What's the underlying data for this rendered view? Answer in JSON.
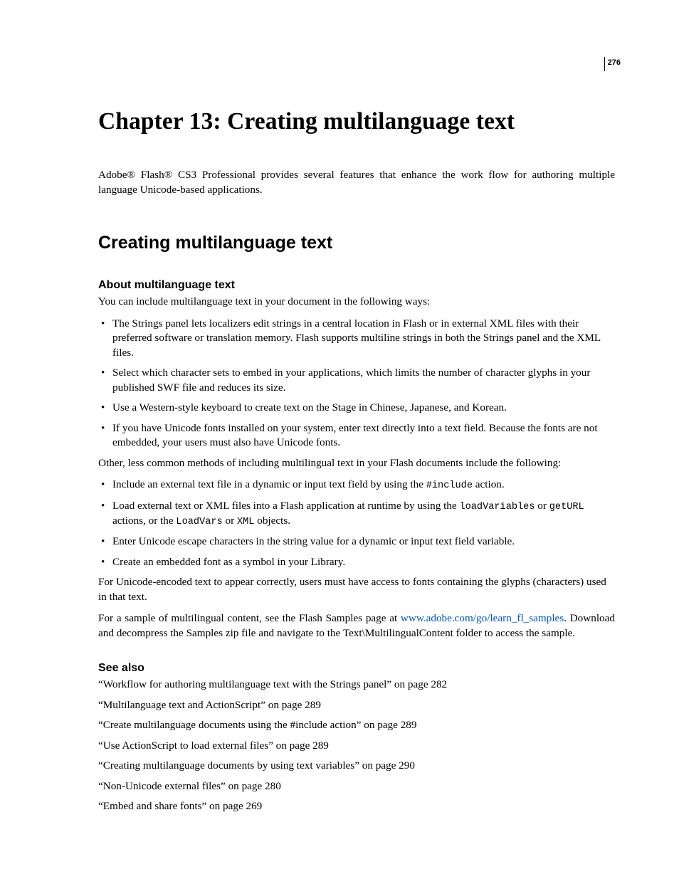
{
  "page_number": "276",
  "chapter_title": "Chapter 13: Creating multilanguage text",
  "intro": "Adobe® Flash® CS3 Professional provides several features that enhance the work flow for authoring multiple language Unicode-based applications.",
  "section_heading": "Creating multilanguage text",
  "subsection_heading": "About multilanguage text",
  "lead_in": "You can include multilanguage text in your document in the following ways:",
  "bullets_primary": [
    "The Strings panel lets localizers edit strings in a central location in Flash or in external XML files with their preferred software or translation memory. Flash supports multiline strings in both the Strings panel and the XML files.",
    "Select which character sets to embed in your applications, which limits the number of character glyphs in your published SWF file and reduces its size.",
    "Use a Western-style keyboard to create text on the Stage in Chinese, Japanese, and Korean.",
    "If you have Unicode fonts installed on your system, enter text directly into a text field. Because the fonts are not embedded, your users must also have Unicode fonts."
  ],
  "mid_para": "Other, less common methods of including multilingual text in your Flash documents include the following:",
  "bullet_include_pre": "Include an external text file in a dynamic or input text field by using the ",
  "bullet_include_code": "#include",
  "bullet_include_post": " action.",
  "bullet_load_pre": "Load external text or XML files into a Flash application at runtime by using the ",
  "bullet_load_code1": "loadVariables",
  "bullet_load_or1": " or ",
  "bullet_load_code2": "getURL",
  "bullet_load_mid": " actions, or the ",
  "bullet_load_code3": "LoadVars",
  "bullet_load_or2": " or ",
  "bullet_load_code4": "XML",
  "bullet_load_post": " objects.",
  "bullets_secondary_tail": [
    "Enter Unicode escape characters in the string value for a dynamic or input text field variable.",
    "Create an embedded font as a symbol in your Library."
  ],
  "unicode_para": "For Unicode-encoded text to appear correctly, users must have access to fonts containing the glyphs (characters) used in that text.",
  "sample_pre": "For a sample of multilingual content, see the Flash Samples page at ",
  "sample_link": "www.adobe.com/go/learn_fl_samples",
  "sample_post": ". Download and decompress the Samples zip file and navigate to the Text\\MultilingualContent folder to access the sample.",
  "see_also_heading": "See also",
  "see_also": [
    "“Workflow for authoring multilanguage text with the Strings panel” on page 282",
    "“Multilanguage text and ActionScript” on page 289",
    "“Create multilanguage documents using the #include action” on page 289",
    "“Use ActionScript to load external files” on page 289",
    "“Creating multilanguage documents by using text variables” on page 290",
    "“Non-Unicode external files” on page 280",
    "“Embed and share fonts” on page 269"
  ]
}
